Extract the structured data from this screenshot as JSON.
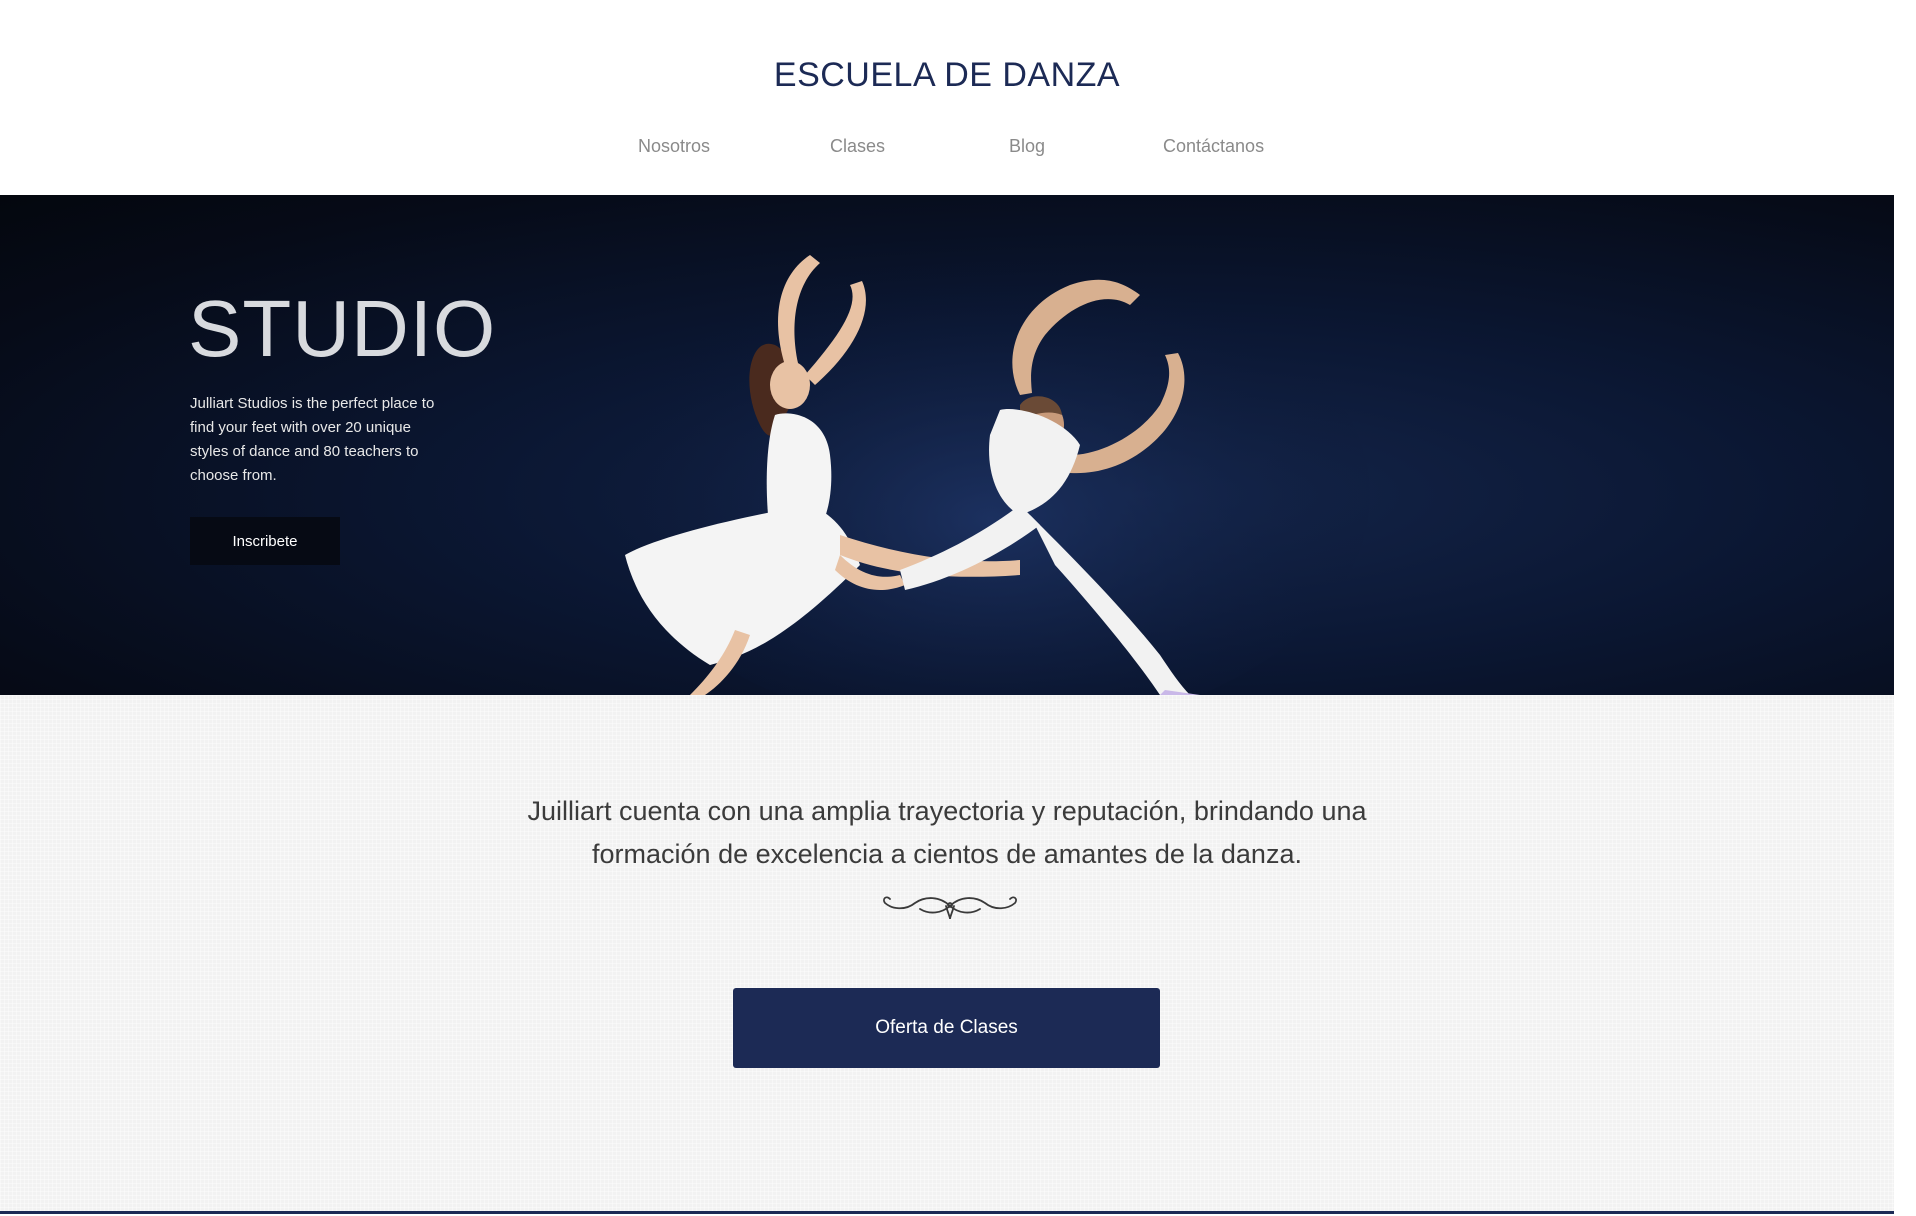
{
  "header": {
    "brand": "ESCUELA DE DANZA",
    "nav": [
      {
        "label": "Nosotros"
      },
      {
        "label": "Clases"
      },
      {
        "label": "Blog"
      },
      {
        "label": "Contáctanos"
      }
    ]
  },
  "hero": {
    "title": "STUDIO",
    "text": "Julliart Studios is the perfect place to find your feet with over 20 unique styles of dance and 80 teachers to choose from.",
    "button_label": "Inscribete",
    "image_icon": "dancers-photo"
  },
  "main": {
    "tagline_line1": "Juilliart cuenta con una amplia trayectoria y reputación, brindando una",
    "tagline_line2": "formación de excelencia a cientos de amantes de la danza.",
    "ornament_icon": "flourish-divider-icon",
    "cta_label": "Oferta de Clases"
  },
  "colors": {
    "brand_navy": "#1c2a55",
    "hero_bg": "#0b1733",
    "content_bg": "#f2f2f2",
    "nav_text": "#8a8a8a"
  }
}
